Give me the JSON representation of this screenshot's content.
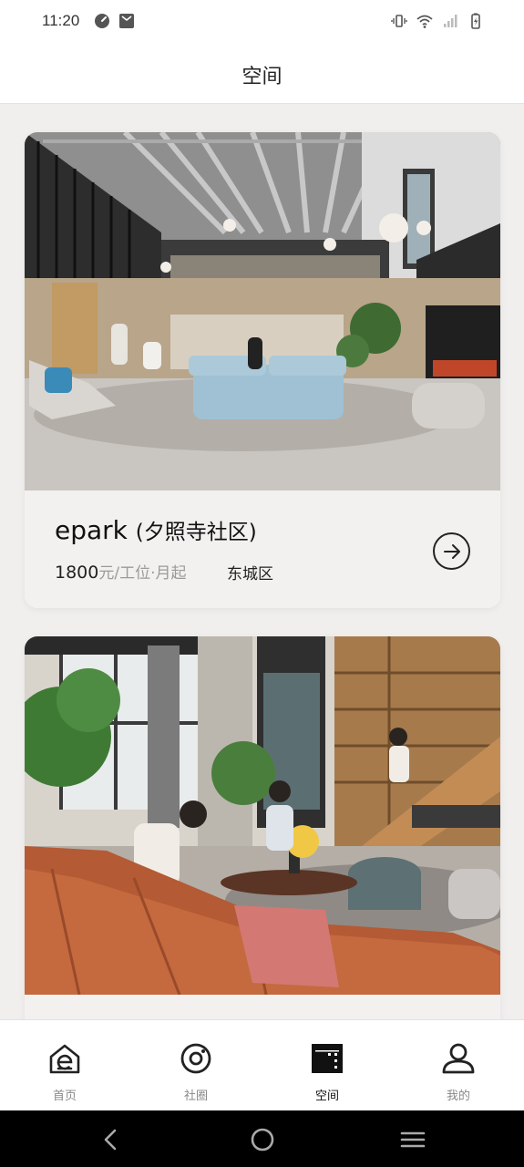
{
  "status_bar": {
    "time": "11:20",
    "left_icons": [
      "speedometer-icon",
      "notification-icon"
    ],
    "right_icons": [
      "vibrate-icon",
      "wifi-icon",
      "signal-icon",
      "battery-icon"
    ]
  },
  "header": {
    "title": "空间"
  },
  "spaces": [
    {
      "name": "epark",
      "name_suffix": "(夕照寺社区)",
      "price": "1800",
      "price_unit": "元/工位·月起",
      "district": "东城区"
    },
    {
      "name": "",
      "name_suffix": "",
      "price": "",
      "price_unit": "",
      "district": ""
    }
  ],
  "bottom_nav": {
    "items": [
      {
        "label": "首页",
        "icon": "home-e-icon",
        "active": false
      },
      {
        "label": "社圈",
        "icon": "community-circle-icon",
        "active": false
      },
      {
        "label": "空间",
        "icon": "space-building-icon",
        "active": true
      },
      {
        "label": "我的",
        "icon": "profile-icon",
        "active": false
      }
    ]
  },
  "system_nav": [
    "back-icon",
    "home-icon",
    "menu-icon"
  ],
  "colors": {
    "background": "#f1efee",
    "card": "#f3f1ef",
    "text": "#222222",
    "muted": "#9a9a9a",
    "active": "#111111",
    "inactive": "#888888"
  }
}
